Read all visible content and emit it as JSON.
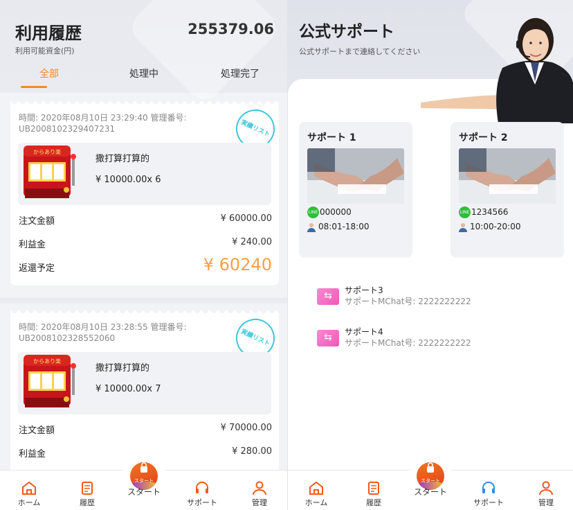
{
  "history": {
    "title": "利用履歴",
    "subtitle": "利用可能資金(円)",
    "balance": "255379.06",
    "tabs": [
      {
        "label": "全部",
        "active": true
      },
      {
        "label": "処理中",
        "active": false
      },
      {
        "label": "処理完了",
        "active": false
      }
    ],
    "orders": [
      {
        "time_label": "時間:",
        "time": "2020年08月10日 23:29:40",
        "id_label": "管理番号:",
        "id": "UB2008102329407231",
        "stamp": "実績リスト",
        "product_name": "撒打算打算的",
        "product_price": "¥ 10000.00x 6",
        "rows": [
          {
            "label": "注文金額",
            "value": "¥ 60000.00"
          },
          {
            "label": "利益金",
            "value": "¥ 240.00"
          }
        ],
        "return_label": "返還予定",
        "return_value": "¥ 60240"
      },
      {
        "time_label": "時間:",
        "time": "2020年08月10日 23:28:55",
        "id_label": "管理番号:",
        "id": "UB2008102328552060",
        "stamp": "実績リスト",
        "product_name": "撒打算打算的",
        "product_price": "¥ 10000.00x 7",
        "rows": [
          {
            "label": "注文金額",
            "value": "¥ 70000.00"
          },
          {
            "label": "利益金",
            "value": "¥ 280.00"
          }
        ]
      }
    ]
  },
  "support": {
    "title": "公式サポート",
    "subtitle": "公式サポートまで連絡してください",
    "cards": [
      {
        "title": "サポート 1",
        "line_badge": "LINE",
        "line_id": "000000",
        "hours": "08:01-18:00"
      },
      {
        "title": "サポート 2",
        "line_badge": "LINE",
        "line_id": "1234566",
        "hours": "10:00-20:00"
      }
    ],
    "mchat": [
      {
        "name": "サポート3",
        "detail": "サポートMChat号: 2222222222",
        "icon_glyph": "⇆"
      },
      {
        "name": "サポート4",
        "detail": "サポートMChat号: 2222222222",
        "icon_glyph": "⇆"
      }
    ]
  },
  "nav": {
    "home": "ホーム",
    "history": "履歴",
    "start": "スタート",
    "start_badge": "スタート",
    "support": "サポート",
    "manage": "管理"
  },
  "colors": {
    "accent": "#f08a24",
    "nav_active": "#f05a1a",
    "support_active": "#2a8ee8"
  },
  "icons": {
    "home": "home-icon",
    "history": "document-icon",
    "start": "lock-bag-icon",
    "support": "headset-icon",
    "manage": "user-icon"
  }
}
